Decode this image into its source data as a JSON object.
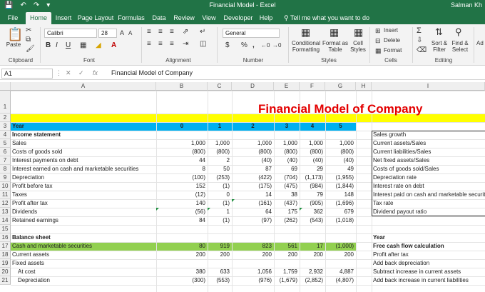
{
  "titlebar": {
    "title": "Financial Model  -  Excel",
    "user": "Salman Kh"
  },
  "tabs": [
    "File",
    "Home",
    "Insert",
    "Page Layout",
    "Formulas",
    "Data",
    "Review",
    "View",
    "Developer",
    "Help"
  ],
  "tell_me": "Tell me what you want to do",
  "ribbon": {
    "clipboard": {
      "paste": "Paste",
      "label": "Clipboard"
    },
    "font": {
      "name": "Calibri",
      "size": "28",
      "bold": "B",
      "italic": "I",
      "underline": "U",
      "grow": "A",
      "shrink": "A",
      "label": "Font"
    },
    "alignment": {
      "label": "Alignment"
    },
    "number": {
      "format": "General",
      "currency": "$",
      "percent": "%",
      "comma": ",",
      "label": "Number"
    },
    "styles": {
      "conditional": "Conditional Formatting",
      "format_table": "Format as Table",
      "cell_styles": "Cell Styles",
      "label": "Styles"
    },
    "cells": {
      "insert": "Insert",
      "delete": "Delete",
      "format": "Format",
      "label": "Cells"
    },
    "editing": {
      "sort": "Sort & Filter",
      "find": "Find & Select",
      "label": "Editing",
      "sigma": "Σ"
    },
    "addins": {
      "label": "Ad"
    }
  },
  "formula_bar": {
    "name_box": "A1",
    "fx": "fx",
    "formula": "Financial Model of Company"
  },
  "columns": [
    "A",
    "B",
    "C",
    "D",
    "E",
    "F",
    "G",
    "H",
    "I"
  ],
  "rows": [
    "1",
    "2",
    "3",
    "4",
    "5",
    "6",
    "7",
    "8",
    "9",
    "10",
    "11",
    "12",
    "13",
    "14",
    "15",
    "16",
    "17",
    "18",
    "19",
    "20",
    "21"
  ],
  "sheet": {
    "title": "Financial Model of Company",
    "year_label": "Year",
    "years": [
      "0",
      "1",
      "2",
      "3",
      "4",
      "5"
    ],
    "income_statement": "Income statement",
    "lines": [
      {
        "label": "Sales",
        "values": [
          "1,000",
          "1,000",
          "1,000",
          "1,000",
          "1,000",
          "1,000"
        ]
      },
      {
        "label": "Costs of goods sold",
        "values": [
          "(800)",
          "(800)",
          "(800)",
          "(800)",
          "(800)",
          "(800)"
        ]
      },
      {
        "label": "Interest payments on debt",
        "values": [
          "44",
          "2",
          "(40)",
          "(40)",
          "(40)",
          "(40)"
        ]
      },
      {
        "label": "Interest earned on cash and marketable securities",
        "values": [
          "8",
          "50",
          "87",
          "69",
          "29",
          "49"
        ]
      },
      {
        "label": "Depreciation",
        "values": [
          "(100)",
          "(253)",
          "(422)",
          "(704)",
          "(1,173)",
          "(1,955)"
        ]
      },
      {
        "label": "Profit before tax",
        "values": [
          "152",
          "(1)",
          "(175)",
          "(475)",
          "(984)",
          "(1,844)"
        ]
      },
      {
        "label": "Taxes",
        "values": [
          "(12)",
          "0",
          "14",
          "38",
          "79",
          "148"
        ]
      },
      {
        "label": "Profit after tax",
        "values": [
          "140",
          "(1)",
          "(161)",
          "(437)",
          "(905)",
          "(1,696)"
        ]
      },
      {
        "label": "Dividends",
        "values": [
          "(56)",
          "1",
          "64",
          "175",
          "362",
          "679"
        ]
      },
      {
        "label": "Retained earnings",
        "values": [
          "84",
          "(1)",
          "(97)",
          "(262)",
          "(543)",
          "(1,018)"
        ]
      }
    ],
    "dash_f8": "-",
    "balance_sheet": "Balance sheet",
    "bs_lines": [
      {
        "label": "Cash and marketable securities",
        "values": [
          "80",
          "919",
          "823",
          "561",
          "17",
          "(1,000)"
        ]
      },
      {
        "label": "Current assets",
        "values": [
          "200",
          "200",
          "200",
          "200",
          "200",
          "200"
        ]
      },
      {
        "label": "Fixed assets",
        "values": [
          "",
          "",
          "",
          "",
          "",
          ""
        ]
      },
      {
        "label": "At cost",
        "values": [
          "380",
          "633",
          "1,056",
          "1,759",
          "2,932",
          "4,887"
        ]
      },
      {
        "label": "Depreciation",
        "values": [
          "(300)",
          "(553)",
          "(976)",
          "(1,679)",
          "(2,852)",
          "(4,807)"
        ]
      }
    ],
    "col_i_top": [
      "Sales growth",
      "Current assets/Sales",
      "Current liabilities/Sales",
      "Net fixed assets/Sales",
      "Costs of goods sold/Sales",
      "Depreciation rate",
      "Interest rate on debt",
      "Interest paid on cash and marketable securities",
      "Tax rate",
      "Dividend payout ratio"
    ],
    "col_i_year": "Year",
    "col_i_fcf": "Free cash flow calculation",
    "col_i_bottom": [
      "Profit after tax",
      "Add back depreciation",
      "Subtract increase in current assets",
      "Add back increase in current liabilities"
    ]
  },
  "colors": {
    "excel_green": "#217346",
    "title_band": "#ffff00",
    "year_band": "#00b0f0",
    "cash_band": "#92d050",
    "title_text": "#e30000"
  }
}
